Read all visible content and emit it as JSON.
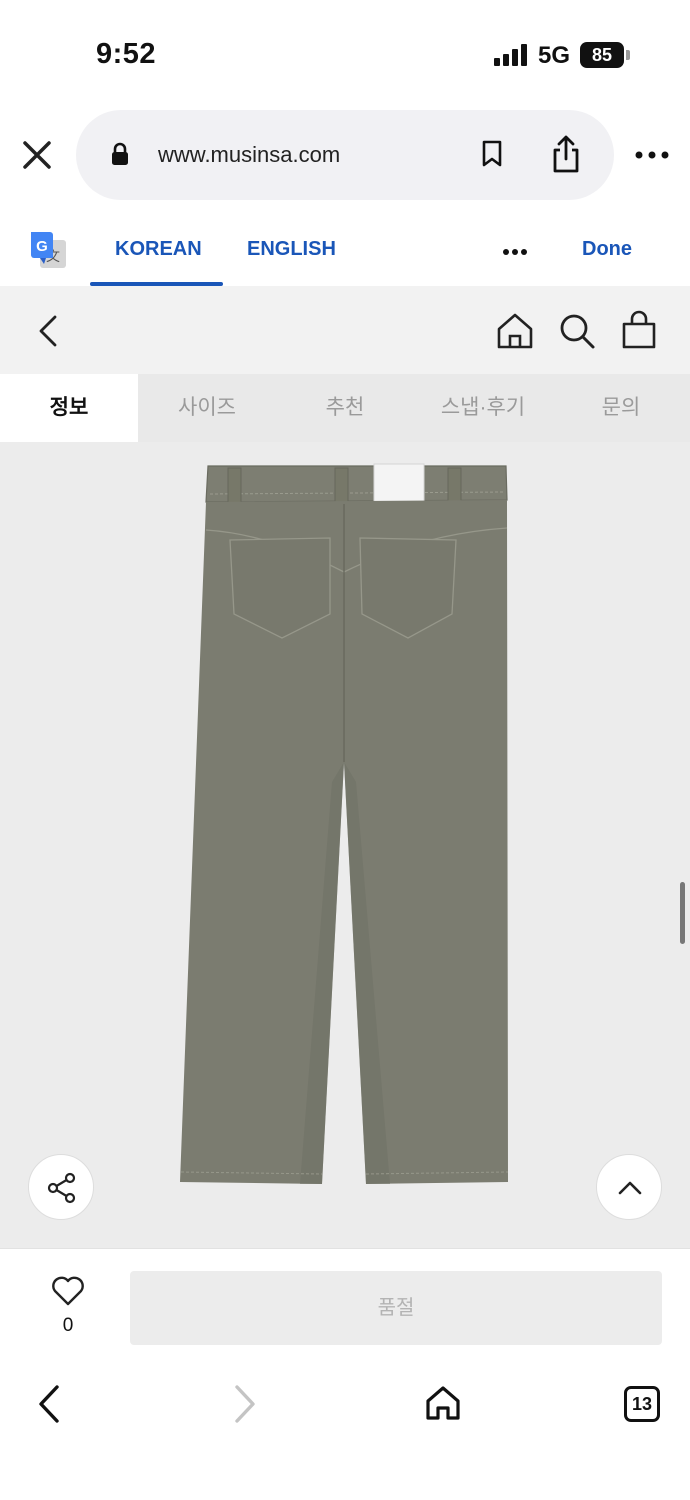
{
  "status_bar": {
    "time": "9:52",
    "network": "5G",
    "battery": "85"
  },
  "browser": {
    "url": "www.musinsa.com"
  },
  "translate": {
    "korean": "KOREAN",
    "english": "ENGLISH",
    "done": "Done"
  },
  "tabs": [
    {
      "label": "정보",
      "active": true
    },
    {
      "label": "사이즈",
      "active": false
    },
    {
      "label": "추천",
      "active": false
    },
    {
      "label": "스냅·후기",
      "active": false
    },
    {
      "label": "문의",
      "active": false
    }
  ],
  "buy_bar": {
    "like_count": "0",
    "soldout_label": "품절"
  },
  "bottom_toolbar": {
    "tab_count": "13"
  },
  "colors": {
    "accent_blue": "#1a56b8",
    "pants_olive": "#7b7c70",
    "header_bg": "#f2f2f2"
  }
}
